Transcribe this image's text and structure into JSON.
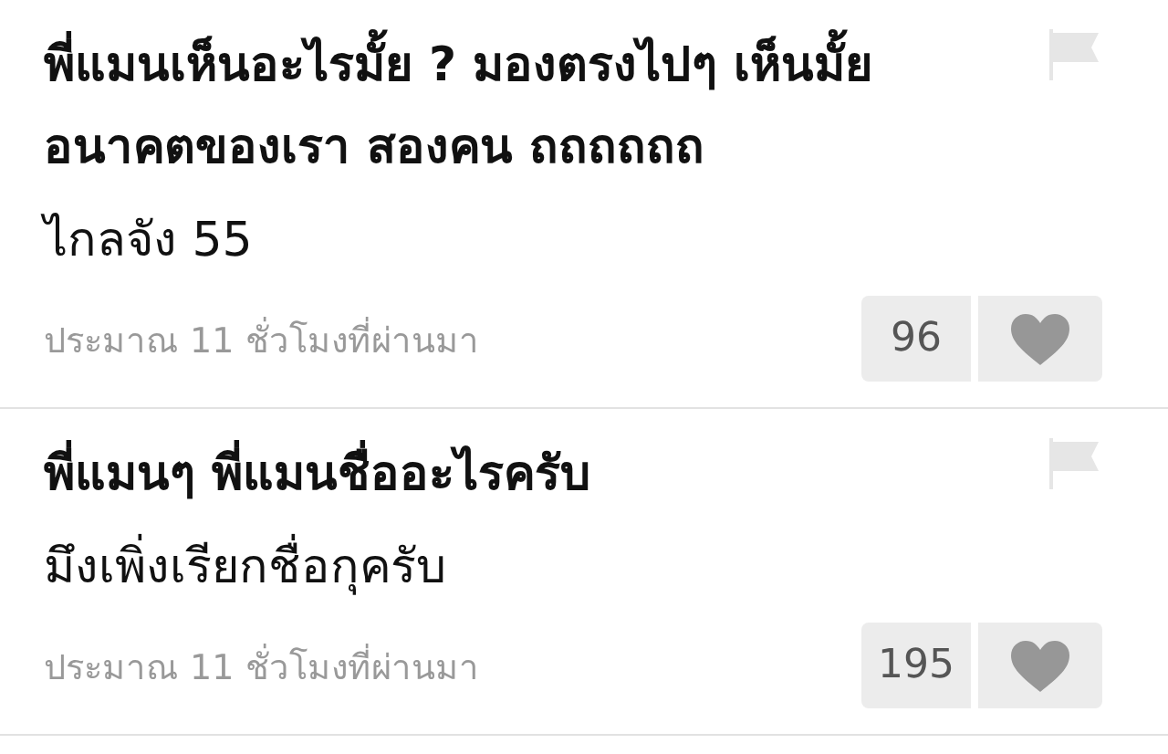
{
  "posts": [
    {
      "question": "พี่แมนเห็นอะไรมั้ย ? มองตรงไปๆ เห็นมั้ย อนาคตของเรา สองคน ถถถถถถ",
      "answer": "ไกลจัง 55",
      "time": "ประมาณ 11 ชั่วโมงที่ผ่านมา",
      "likes": "96"
    },
    {
      "question": "พี่แมนๆ พี่แมนชื่ออะไรครับ",
      "answer": "มึงเพิ่งเรียกชื่อกุครับ",
      "time": "ประมาณ 11 ชั่วโมงที่ผ่านมา",
      "likes": "195"
    }
  ]
}
